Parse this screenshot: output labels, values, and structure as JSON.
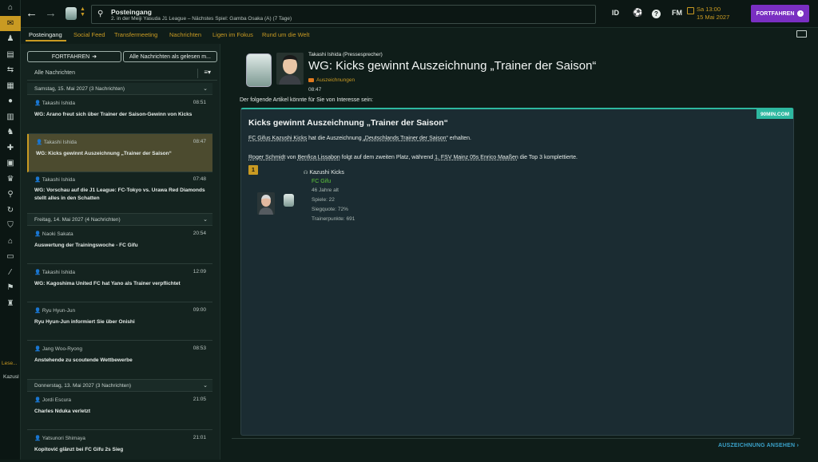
{
  "sidebar": {
    "icons": [
      "home-icon",
      "inbox-icon",
      "squad-icon",
      "clipboard-icon",
      "transfer-icon",
      "calendar-icon",
      "ball-icon",
      "chart-icon",
      "team-icon",
      "medical-icon",
      "schedule-icon",
      "trophy-icon",
      "search-icon",
      "refresh-icon",
      "shield-icon",
      "training-icon",
      "stadium-icon",
      "cards-icon",
      "pitch-icon",
      "people-icon"
    ],
    "reading_label": "Lese...",
    "reading_name": "Kazusl"
  },
  "topbar": {
    "title": "Posteingang",
    "subtitle": "2. in der Meiji Yasuda J1 League – Nächstes Spiel: Gamba Osaka (A) (7 Tage)",
    "id_label": "ID",
    "fm_label": "FM",
    "help_label": "?",
    "date_line1": "Sa 13:00",
    "date_line2": "15 Mai 2027",
    "continue_label": "FORTFAHREN"
  },
  "tabs": [
    "Posteingang",
    "Social Feed",
    "Transfermeeting",
    "Nachrichten",
    "Ligen im Fokus",
    "Rund um die Welt"
  ],
  "left": {
    "continue_label": "FORTFAHREN",
    "mark_all_label": "Alle Nachrichten als gelesen m...",
    "filter_label": "Alle Nachrichten",
    "groups": [
      {
        "header": "Samstag, 15. Mai 2027 (3 Nachrichten)",
        "messages": [
          {
            "from": "Takashi Ishida",
            "time": "08:51",
            "subject": "WG: Arano freut sich über Trainer der Saison-Gewinn von Kicks"
          },
          {
            "from": "Takashi Ishida",
            "time": "08:47",
            "subject": "WG: Kicks gewinnt Auszeichnung „Trainer der Saison“"
          },
          {
            "from": "Takashi Ishida",
            "time": "07:48",
            "subject": "WG: Vorschau auf die J1 League: FC-Tokyo vs. Urawa Red Diamonds stellt alles in den Schatten"
          }
        ]
      },
      {
        "header": "Freitag, 14. Mai 2027 (4 Nachrichten)",
        "messages": [
          {
            "from": "Naoki Sakata",
            "time": "20:54",
            "subject": "Auswertung der Trainingswoche - FC Gifu"
          },
          {
            "from": "Takashi Ishida",
            "time": "12:09",
            "subject": "WG: Kagoshima United FC hat Yano als Trainer verpflichtet"
          },
          {
            "from": "Ryu Hyun-Jun",
            "time": "09:00",
            "subject": "Ryu Hyun-Jun informiert Sie über Onishi"
          },
          {
            "from": "Jang Woo-Ryong",
            "time": "08:53",
            "subject": "Anstehende zu scoutende Wettbewerbe"
          }
        ]
      },
      {
        "header": "Donnerstag, 13. Mai 2027 (3 Nachrichten)",
        "messages": [
          {
            "from": "Jordi Escura",
            "time": "21:05",
            "subject": "Charles Nduka verletzt"
          },
          {
            "from": "Yatsunori Shimaya",
            "time": "21:01",
            "subject": "Kopitović glänzt bei FC Gifu 2s Sieg"
          }
        ]
      }
    ]
  },
  "message": {
    "sender": "Takashi Ishida  (Pressesprecher)",
    "headline": "WG: Kicks gewinnt Auszeichnung „Trainer der Saison“",
    "category": "Auszeichnungen",
    "time": "08:47",
    "intro": "Der folgende Artikel könnte für Sie von Interesse sein:",
    "article": {
      "source": "90MIN.COM",
      "title": "Kicks gewinnt Auszeichnung „Trainer der Saison“",
      "line1_a": "FC Gifus Kazushi Kicks",
      "line1_b": " hat die Auszeichnung ",
      "line1_c": "„Deutschlands Trainer der Saison“",
      "line1_d": " erhalten.",
      "line2_a": "Roger Schmidt",
      "line2_b": " von ",
      "line2_c": "Benfica Lissabon",
      "line2_d": " folgt auf dem zweiten Platz, während ",
      "line2_e": "1. FSV Mainz 05s Enrico Maaßen",
      "line2_f": " die Top 3 komplettierte.",
      "rank": "1",
      "person": {
        "name": "Kazushi Kicks",
        "club": "FC Gifu",
        "age": "46 Jahre alt",
        "games": "Spiele: 22",
        "winrate": "Siegquote: 72%",
        "points": "Trainerpunkte: 691"
      }
    },
    "view_label": "AUSZEICHNUNG ANSEHEN"
  },
  "colors": {
    "accent": "#c99a22",
    "purple": "#7a2fc2",
    "teal": "#2eb8a0",
    "link": "#3aa1c9"
  }
}
